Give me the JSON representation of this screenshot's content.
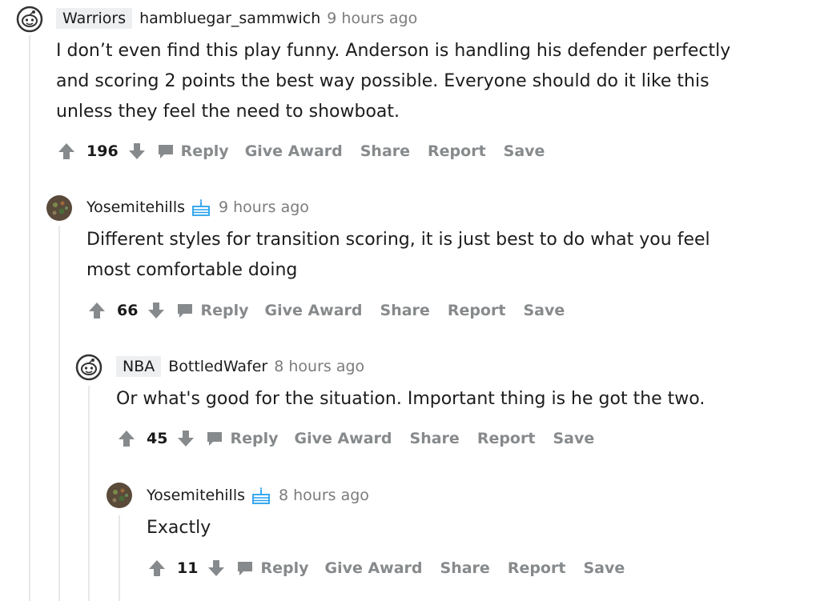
{
  "comments": [
    {
      "flair": "Warriors",
      "author": "hambluegar_sammwich",
      "time": "9 hours ago",
      "body": [
        "I don’t even find this play funny. Anderson is handling his defender perfectly",
        "and scoring 2 points the best way possible. Everyone should do it like this",
        "unless they feel the need to showboat."
      ],
      "score": "196",
      "avatar": "snoo-icon"
    },
    {
      "author": "Yosemitehills",
      "time": "9 hours ago",
      "body": [
        "Different styles for transition scoring, it is just best to do what you feel",
        "most comfortable doing"
      ],
      "score": "66",
      "avatar": "user-avatar",
      "badge": "cake-day-icon"
    },
    {
      "flair": "NBA",
      "author": "BottledWafer",
      "time": "8 hours ago",
      "body": [
        "Or what's good for the situation. Important thing is he got the two."
      ],
      "score": "45",
      "avatar": "snoo-icon"
    },
    {
      "author": "Yosemitehills",
      "time": "8 hours ago",
      "body": [
        "Exactly"
      ],
      "score": "11",
      "avatar": "user-avatar",
      "badge": "cake-day-icon"
    }
  ],
  "actions": {
    "reply": "Reply",
    "give_award": "Give Award",
    "share": "Share",
    "report": "Report",
    "save": "Save"
  },
  "colors": {
    "action_text": "#878a8c",
    "flair_bg": "#edeff1",
    "thread_line": "#e8e8e8",
    "time_text": "#7c7c7c",
    "cake_blue": "#24a0ed"
  }
}
